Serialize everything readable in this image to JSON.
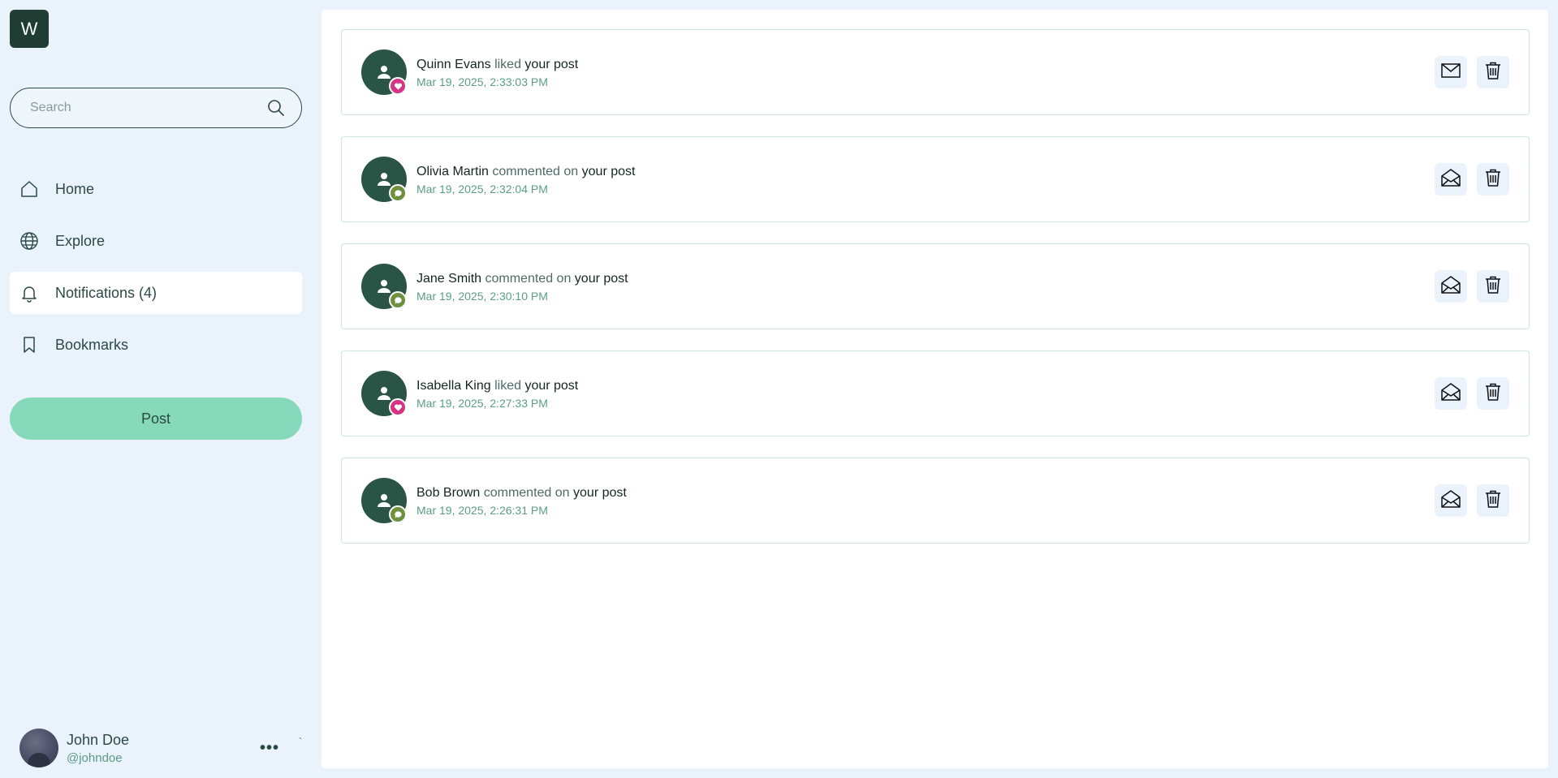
{
  "app": {
    "logo_letter": "W"
  },
  "search": {
    "placeholder": "Search"
  },
  "nav": {
    "items": [
      {
        "label": "Home",
        "icon": "home-icon"
      },
      {
        "label": "Explore",
        "icon": "globe-icon"
      },
      {
        "label": "Notifications (4)",
        "icon": "bell-icon",
        "active": true
      },
      {
        "label": "Bookmarks",
        "icon": "bookmark-icon"
      }
    ]
  },
  "post_button": {
    "label": "Post"
  },
  "profile": {
    "name": "John Doe",
    "handle": "@johndoe",
    "more": "•••",
    "caret": "`"
  },
  "colors": {
    "like_badge": "#d63384",
    "comment_badge": "#6f8f3e",
    "avatar_bg": "#2a5446",
    "accent": "#86d9bb"
  },
  "notifications": [
    {
      "user": "Quinn Evans",
      "action": "liked",
      "target": "your post",
      "time": "Mar 19, 2025, 2:33:03 PM",
      "type": "like",
      "read": false
    },
    {
      "user": "Olivia Martin",
      "action": "commented on",
      "target": "your post",
      "time": "Mar 19, 2025, 2:32:04 PM",
      "type": "comment",
      "read": true
    },
    {
      "user": "Jane Smith",
      "action": "commented on",
      "target": "your post",
      "time": "Mar 19, 2025, 2:30:10 PM",
      "type": "comment",
      "read": true
    },
    {
      "user": "Isabella King",
      "action": "liked",
      "target": "your post",
      "time": "Mar 19, 2025, 2:27:33 PM",
      "type": "like",
      "read": true
    },
    {
      "user": "Bob Brown",
      "action": "commented on",
      "target": "your post",
      "time": "Mar 19, 2025, 2:26:31 PM",
      "type": "comment",
      "read": true
    }
  ]
}
